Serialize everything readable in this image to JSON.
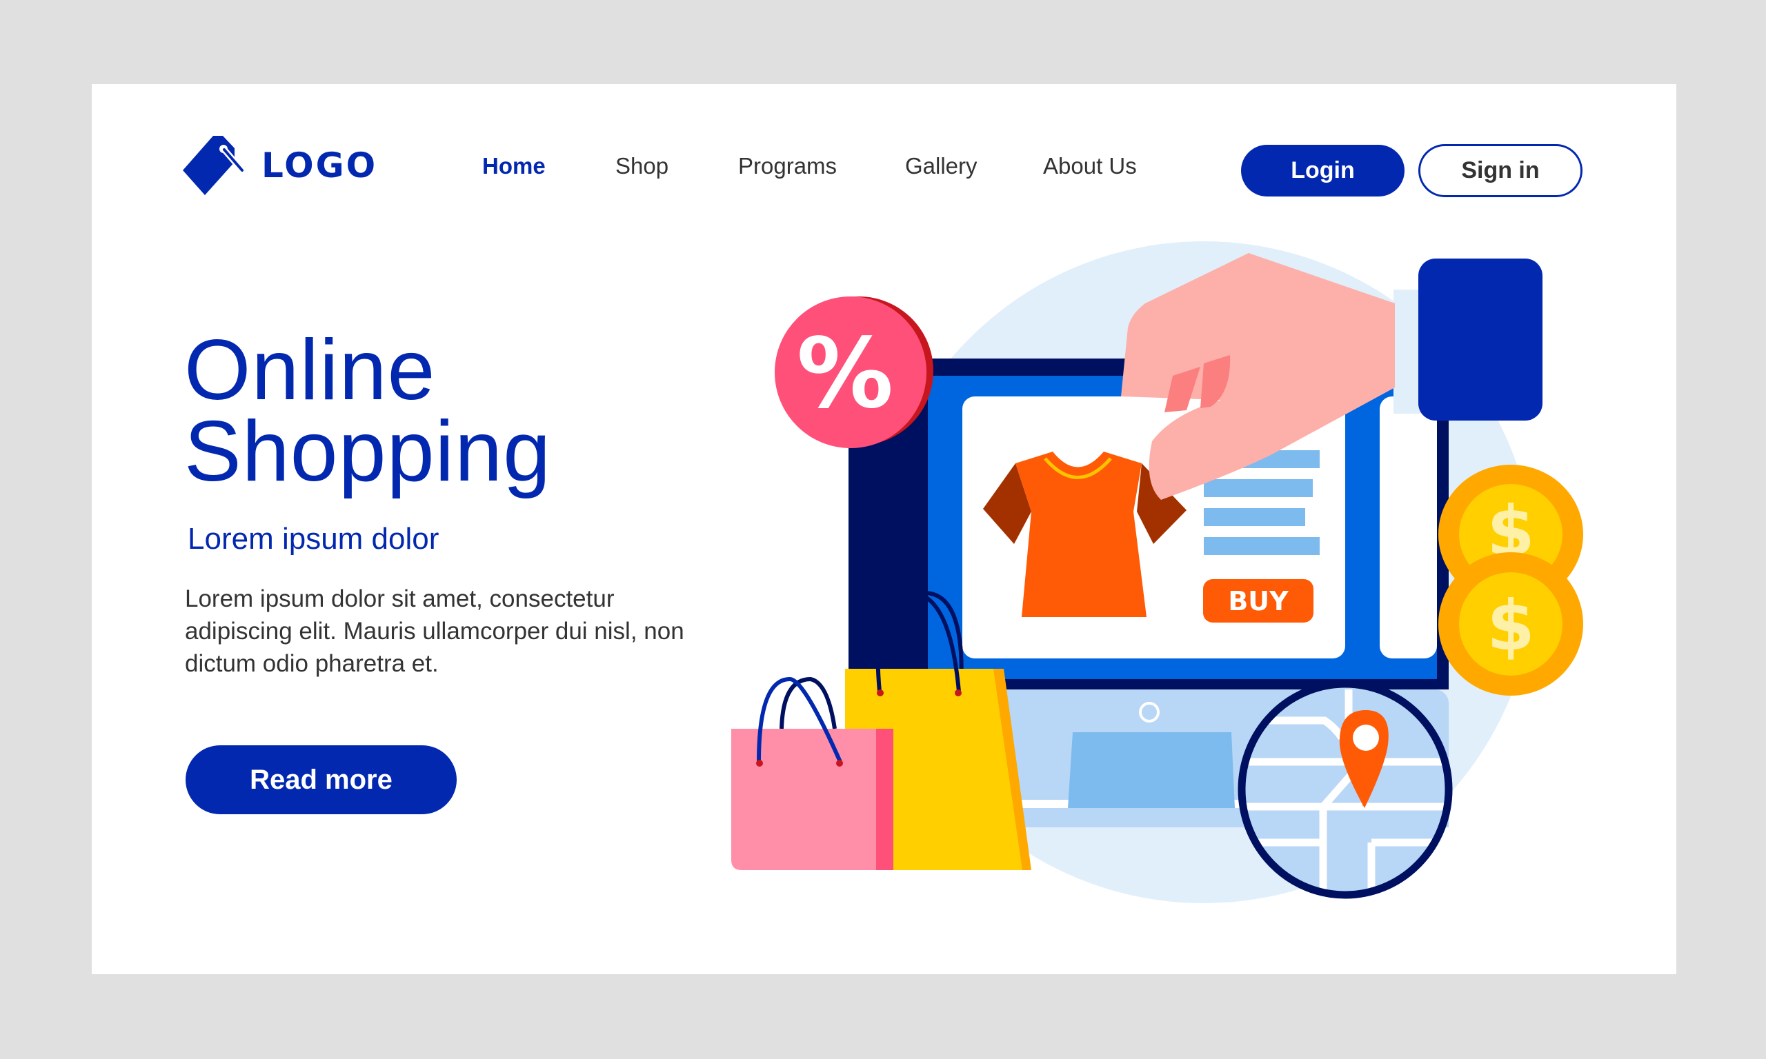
{
  "header": {
    "logo_text": "LOGO",
    "logo_icon": "price-tag-icon",
    "nav": [
      {
        "label": "Home",
        "active": true
      },
      {
        "label": "Shop",
        "active": false
      },
      {
        "label": "Programs",
        "active": false
      },
      {
        "label": "Gallery",
        "active": false
      },
      {
        "label": "About Us",
        "active": false
      }
    ],
    "login_label": "Login",
    "signin_label": "Sign in"
  },
  "hero": {
    "title_line1": "Online",
    "title_line2": "Shopping",
    "subtitle": "Lorem ipsum dolor",
    "body_line1": "Lorem ipsum dolor sit amet, consectetur",
    "body_line2": "adipiscing elit. Mauris ullamcorper dui nisl, non",
    "body_line3": "dictum odio pharetra et.",
    "cta_label": "Read more"
  },
  "illustration": {
    "discount_symbol": "%",
    "buy_label": "BUY",
    "coin_symbol": "$",
    "icons": [
      "percent-badge-icon",
      "t-shirt-icon",
      "dollar-coin-icon",
      "shopping-bag-icon",
      "map-pin-icon",
      "hand-icon",
      "monitor-icon"
    ]
  },
  "colors": {
    "primary": "#0328b0",
    "text": "#333333",
    "page_bg": "#e0e0e0",
    "card_bg": "#ffffff",
    "accent_orange": "#ff5a05",
    "accent_pink": "#ff5079",
    "coin_gold": "#ffa800",
    "screen_blue": "#0066e0"
  }
}
